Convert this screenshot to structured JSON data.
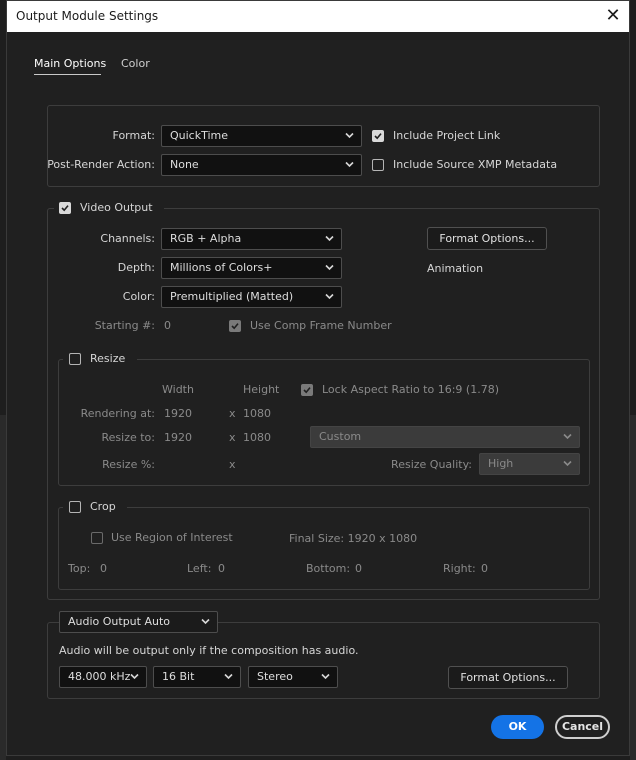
{
  "window": {
    "title": "Output Module Settings",
    "close": "✕"
  },
  "tabs": [
    {
      "label": "Main Options"
    },
    {
      "label": "Color"
    }
  ],
  "main": {
    "format_label": "Format:",
    "format_value": "QuickTime",
    "post_render_label": "Post-Render Action:",
    "post_render_value": "None",
    "include_project_link": {
      "label": "Include Project Link",
      "checked": true
    },
    "include_xmp": {
      "label": "Include Source XMP Metadata",
      "checked": false
    }
  },
  "video": {
    "title": "Video Output",
    "checked": true,
    "channels_label": "Channels:",
    "channels_value": "RGB + Alpha",
    "depth_label": "Depth:",
    "depth_value": "Millions of Colors+",
    "color_label": "Color:",
    "color_value": "Premultiplied (Matted)",
    "format_options_btn": "Format Options...",
    "codec": "Animation",
    "starting_label": "Starting #:",
    "starting_value": "0",
    "use_comp_frame": {
      "label": "Use Comp Frame Number",
      "checked": true
    }
  },
  "resize": {
    "title": "Resize",
    "checked": false,
    "width_header": "Width",
    "height_header": "Height",
    "lock_aspect": {
      "label": "Lock Aspect Ratio to 16:9 (1.78)",
      "checked": true
    },
    "rendering_label": "Rendering at:",
    "rendering_w": "1920",
    "rendering_h": "1080",
    "resize_to_label": "Resize to:",
    "resize_w": "1920",
    "resize_h": "1080",
    "preset_value": "Custom",
    "resize_pct_label": "Resize %:",
    "x_sep": "x",
    "quality_label": "Resize Quality:",
    "quality_value": "High"
  },
  "crop": {
    "title": "Crop",
    "checked": false,
    "use_roi": {
      "label": "Use Region of Interest",
      "checked": false
    },
    "final_size": "Final Size: 1920 x 1080",
    "top_label": "Top:",
    "top_value": "0",
    "left_label": "Left:",
    "left_value": "0",
    "bottom_label": "Bottom:",
    "bottom_value": "0",
    "right_label": "Right:",
    "right_value": "0"
  },
  "audio": {
    "mode_value": "Audio Output Auto",
    "note": "Audio will be output only if the composition has audio.",
    "rate_value": "48.000 kHz",
    "bits_value": "16 Bit",
    "channels_value": "Stereo",
    "format_options_btn": "Format Options..."
  },
  "footer": {
    "ok": "OK",
    "cancel": "Cancel"
  },
  "colors": {
    "accent": "#1473e6",
    "panel": "#202020",
    "field": "#111111"
  }
}
